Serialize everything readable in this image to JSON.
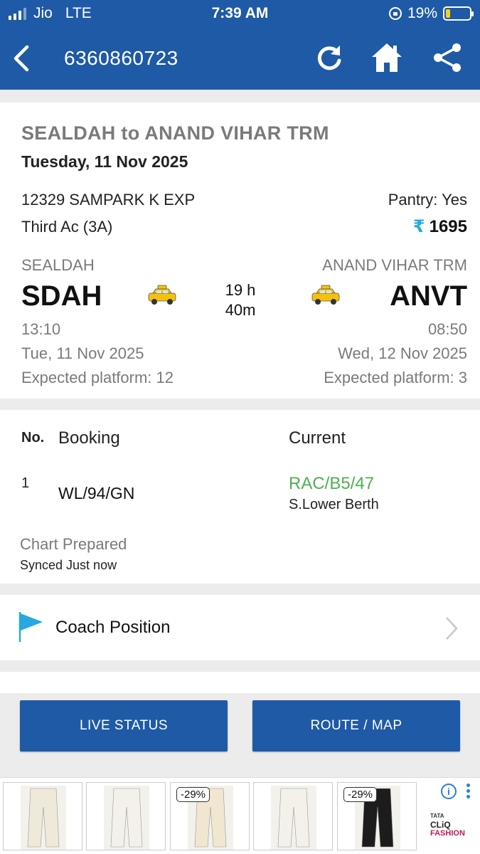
{
  "status_bar": {
    "carrier": "Jio",
    "network": "LTE",
    "time": "7:39 AM",
    "battery_percent": "19%",
    "battery_level": 0.19,
    "battery_color": "#f4d21b"
  },
  "app_bar": {
    "title": "6360860723",
    "icons": [
      "back-icon",
      "refresh-icon",
      "home-icon",
      "share-icon"
    ],
    "color": "#1f5aa6"
  },
  "journey": {
    "route": "SEALDAH to ANAND VIHAR TRM",
    "date": "Tuesday, 11 Nov 2025",
    "train": "12329 SAMPARK K EXP",
    "class": "Third Ac (3A)",
    "pantry": "Pantry: Yes",
    "fare_symbol": "₹",
    "fare": "1695",
    "duration_line1": "19 h",
    "duration_line2": "40m",
    "from": {
      "name": "SEALDAH",
      "code": "SDAH",
      "time": "13:10",
      "date": "Tue, 11 Nov 2025",
      "platform": "Expected platform: 12"
    },
    "to": {
      "name": "ANAND VIHAR TRM",
      "code": "ANVT",
      "time": "08:50",
      "date": "Wed, 12 Nov 2025",
      "platform": "Expected platform: 3"
    }
  },
  "booking": {
    "header_no": "No.",
    "header_booking": "Booking",
    "header_current": "Current",
    "rows": [
      {
        "no": "1",
        "booking": "WL/94/GN",
        "current": "RAC/B5/47",
        "berth": "S.Lower Berth"
      }
    ],
    "chart_status": "Chart Prepared",
    "sync_status": "Synced Just now",
    "current_color": "#4cb04f"
  },
  "coach_position": {
    "label": "Coach Position"
  },
  "buttons": {
    "live_status": "LIVE STATUS",
    "route_map": "ROUTE / MAP"
  },
  "ad": {
    "items": [
      {
        "discount": "",
        "color": "#efe9da"
      },
      {
        "discount": "",
        "color": "#f4f1ea"
      },
      {
        "discount": "-29%",
        "color": "#f1e6cf"
      },
      {
        "discount": "",
        "color": "#f4f1ea"
      },
      {
        "discount": "-29%",
        "color": "#1c1c1c"
      }
    ],
    "brand_line1": "TATA",
    "brand_line2": "CLiQ",
    "brand_line3": "FASHION"
  }
}
